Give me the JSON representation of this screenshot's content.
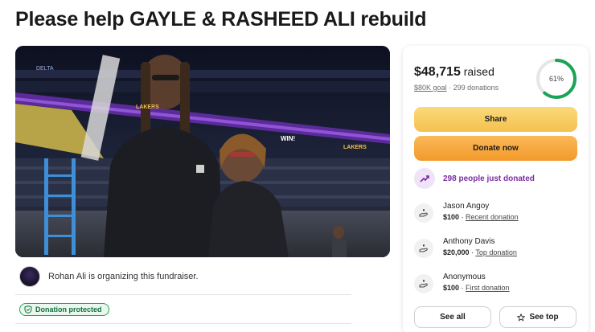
{
  "page": {
    "title": "Please help GAYLE & RASHEED ALI rebuild"
  },
  "hero": {
    "arena_signs": [
      "DELTA",
      "LAKERS",
      "WIN!",
      "LAKERS"
    ]
  },
  "organizer": {
    "text": "Rohan Ali is organizing this fundraiser."
  },
  "badge": {
    "label": "Donation protected"
  },
  "card": {
    "raised_amount": "$48,715",
    "raised_suffix": " raised",
    "goal": "$80K goal",
    "separator": "·",
    "donations": "299 donations",
    "progress_label": "61%",
    "progress_fraction": 0.61,
    "share_label": "Share",
    "donate_label": "Donate now",
    "just_donated": "298 people just donated",
    "donors": [
      {
        "name": "Jason Angoy",
        "amount": "$100",
        "sep": " · ",
        "tag": "Recent donation"
      },
      {
        "name": "Anthony Davis",
        "amount": "$20,000",
        "sep": " · ",
        "tag": "Top donation"
      },
      {
        "name": "Anonymous",
        "amount": "$100",
        "sep": " · ",
        "tag": "First donation"
      }
    ],
    "see_all_label": "See all",
    "see_top_label": "See top"
  },
  "colors": {
    "accent_green": "#1ba356",
    "share_yellow": "#f4c14f",
    "donate_orange": "#f29a2a",
    "purple": "#7a2ca0"
  }
}
